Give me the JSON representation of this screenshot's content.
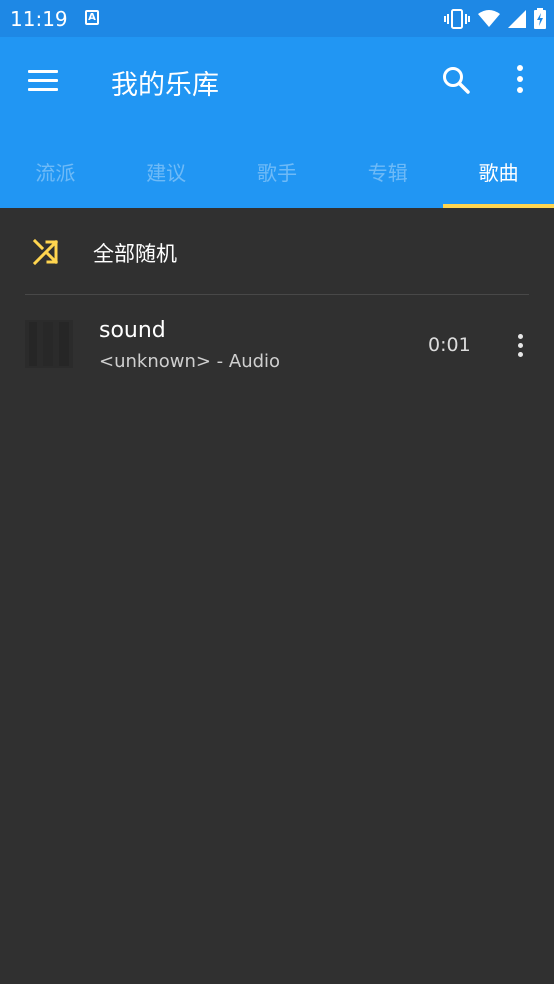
{
  "status_bar": {
    "time": "11:19",
    "notification_icon": "a-icon",
    "icons": [
      "vibrate-icon",
      "wifi-icon",
      "signal-icon",
      "battery-charging-icon"
    ]
  },
  "app_bar": {
    "title": "我的乐库",
    "menu_icon": "hamburger-icon",
    "search_icon": "search-icon",
    "more_icon": "more-vert-icon",
    "color": "#2196F3"
  },
  "tabs": [
    {
      "label": "流派",
      "active": false
    },
    {
      "label": "建议",
      "active": false
    },
    {
      "label": "歌手",
      "active": false
    },
    {
      "label": "专辑",
      "active": false
    },
    {
      "label": "歌曲",
      "active": true
    }
  ],
  "accent": "#FFD54F",
  "shuffle": {
    "label": "全部随机",
    "icon": "shuffle-icon"
  },
  "songs": [
    {
      "title": "sound",
      "subtitle": "<unknown> - Audio",
      "duration": "0:01",
      "art_icon": "album-art-icon"
    }
  ]
}
